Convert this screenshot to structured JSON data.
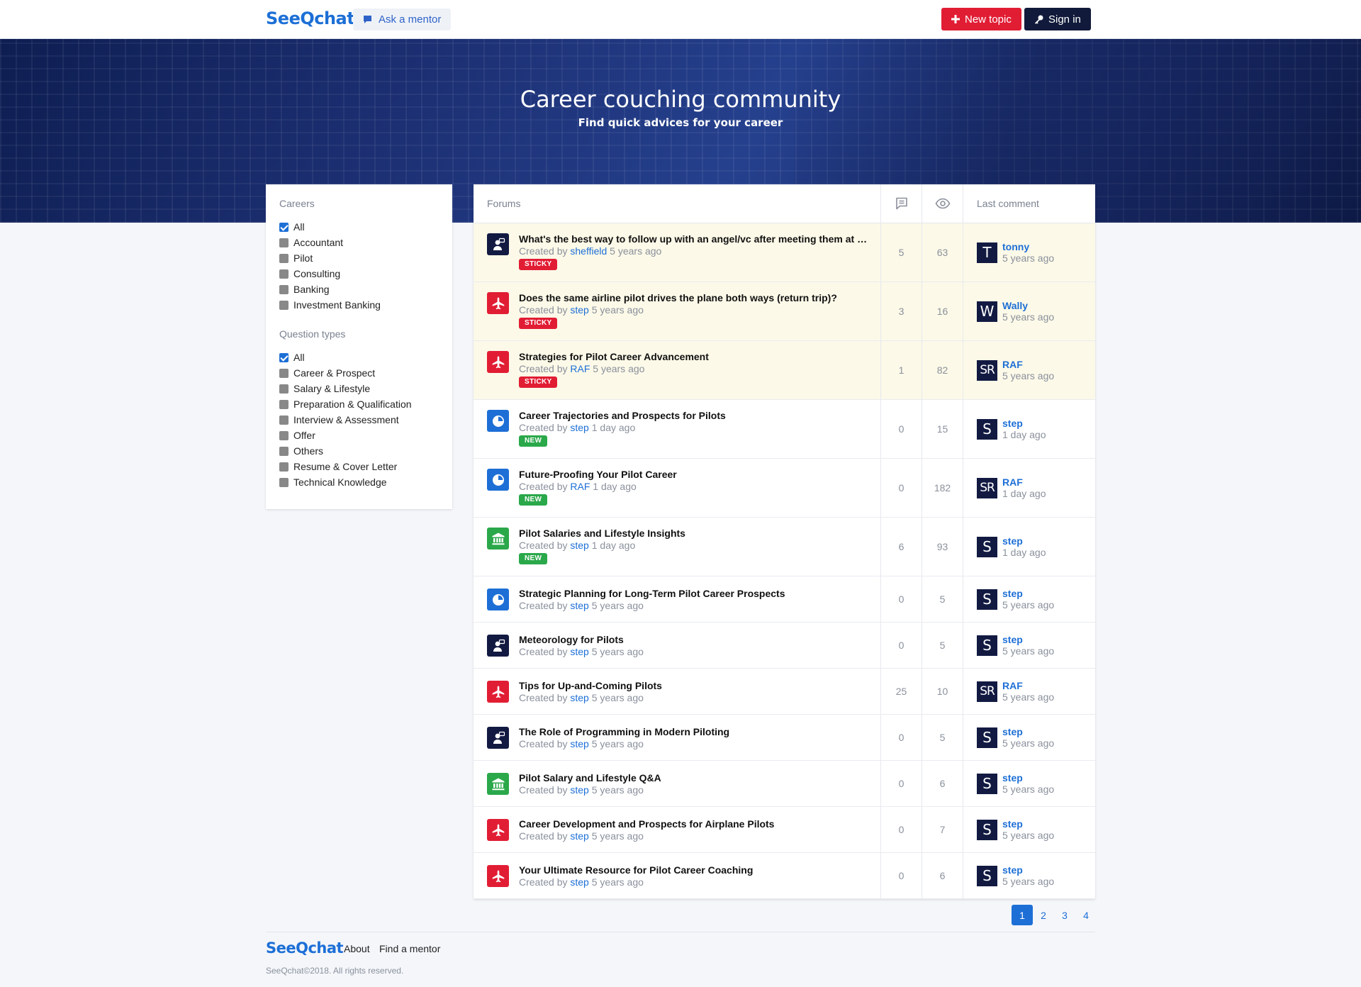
{
  "header": {
    "logo": "SeeQchat",
    "ask_mentor": "Ask a mentor",
    "new_topic": "New topic",
    "sign_in": "Sign in"
  },
  "hero": {
    "title": "Career couching community",
    "subtitle": "Find quick advices for your career"
  },
  "sidebar": {
    "careers_heading": "Careers",
    "careers": [
      {
        "label": "All",
        "checked": true
      },
      {
        "label": "Accountant",
        "checked": false
      },
      {
        "label": "Pilot",
        "checked": false
      },
      {
        "label": "Consulting",
        "checked": false
      },
      {
        "label": "Banking",
        "checked": false
      },
      {
        "label": "Investment Banking",
        "checked": false
      }
    ],
    "types_heading": "Question types",
    "types": [
      {
        "label": "All",
        "checked": true
      },
      {
        "label": "Career & Prospect",
        "checked": false
      },
      {
        "label": "Salary & Lifestyle",
        "checked": false
      },
      {
        "label": "Preparation & Qualification",
        "checked": false
      },
      {
        "label": "Interview & Assessment",
        "checked": false
      },
      {
        "label": "Offer",
        "checked": false
      },
      {
        "label": "Others",
        "checked": false
      },
      {
        "label": "Resume & Cover Letter",
        "checked": false
      },
      {
        "label": "Technical Knowledge",
        "checked": false
      }
    ]
  },
  "table": {
    "col_forums": "Forums",
    "col_last": "Last comment",
    "created_by": "Created by",
    "rows": [
      {
        "title": "What's the best way to follow up with an angel/vc after meeting them at an event?",
        "author": "sheffield",
        "when": "5 years ago",
        "badge": "STICKY",
        "icon": "mentor",
        "replies": "5",
        "views": "63",
        "last_user": "tonny",
        "last_initials": "T",
        "last_when": "5 years ago"
      },
      {
        "title": "Does the same airline pilot drives the plane both ways (return trip)?",
        "author": "step",
        "when": "5 years ago",
        "badge": "STICKY",
        "icon": "plane",
        "replies": "3",
        "views": "16",
        "last_user": "Wally",
        "last_initials": "W",
        "last_when": "5 years ago"
      },
      {
        "title": "Strategies for Pilot Career Advancement",
        "author": "RAF",
        "when": "5 years ago",
        "badge": "STICKY",
        "icon": "plane",
        "replies": "1",
        "views": "82",
        "last_user": "RAF",
        "last_initials": "SR",
        "last_when": "5 years ago"
      },
      {
        "title": "Career Trajectories and Prospects for Pilots",
        "author": "step",
        "when": "1 day ago",
        "badge": "NEW",
        "icon": "chart",
        "replies": "0",
        "views": "15",
        "last_user": "step",
        "last_initials": "S",
        "last_when": "1 day ago"
      },
      {
        "title": "Future-Proofing Your Pilot Career",
        "author": "RAF",
        "when": "1 day ago",
        "badge": "NEW",
        "icon": "chart",
        "replies": "0",
        "views": "182",
        "last_user": "RAF",
        "last_initials": "SR",
        "last_when": "1 day ago"
      },
      {
        "title": "Pilot Salaries and Lifestyle Insights",
        "author": "step",
        "when": "1 day ago",
        "badge": "NEW",
        "icon": "bank",
        "replies": "6",
        "views": "93",
        "last_user": "step",
        "last_initials": "S",
        "last_when": "1 day ago"
      },
      {
        "title": "Strategic Planning for Long-Term Pilot Career Prospects",
        "author": "step",
        "when": "5 years ago",
        "badge": "",
        "icon": "chart",
        "replies": "0",
        "views": "5",
        "last_user": "step",
        "last_initials": "S",
        "last_when": "5 years ago"
      },
      {
        "title": "Meteorology for Pilots",
        "author": "step",
        "when": "5 years ago",
        "badge": "",
        "icon": "mentor",
        "replies": "0",
        "views": "5",
        "last_user": "step",
        "last_initials": "S",
        "last_when": "5 years ago"
      },
      {
        "title": "Tips for Up-and-Coming Pilots",
        "author": "step",
        "when": "5 years ago",
        "badge": "",
        "icon": "plane",
        "replies": "25",
        "views": "10",
        "last_user": "RAF",
        "last_initials": "SR",
        "last_when": "5 years ago"
      },
      {
        "title": "The Role of Programming in Modern Piloting",
        "author": "step",
        "when": "5 years ago",
        "badge": "",
        "icon": "mentor",
        "replies": "0",
        "views": "5",
        "last_user": "step",
        "last_initials": "S",
        "last_when": "5 years ago"
      },
      {
        "title": "Pilot Salary and Lifestyle Q&A",
        "author": "step",
        "when": "5 years ago",
        "badge": "",
        "icon": "bank",
        "replies": "0",
        "views": "6",
        "last_user": "step",
        "last_initials": "S",
        "last_when": "5 years ago"
      },
      {
        "title": "Career Development and Prospects for Airplane Pilots",
        "author": "step",
        "when": "5 years ago",
        "badge": "",
        "icon": "plane",
        "replies": "0",
        "views": "7",
        "last_user": "step",
        "last_initials": "S",
        "last_when": "5 years ago"
      },
      {
        "title": "Your Ultimate Resource for Pilot Career Coaching",
        "author": "step",
        "when": "5 years ago",
        "badge": "",
        "icon": "plane",
        "replies": "0",
        "views": "6",
        "last_user": "step",
        "last_initials": "S",
        "last_when": "5 years ago"
      }
    ]
  },
  "icon_colors": {
    "mentor": "#121a42",
    "plane": "#e11d34",
    "chart": "#1d6fd6",
    "bank": "#2aa84a"
  },
  "pagination": {
    "pages": [
      "1",
      "2",
      "3",
      "4"
    ],
    "current": "1"
  },
  "footer": {
    "logo": "SeeQchat",
    "about": "About",
    "find_mentor": "Find a mentor",
    "copyright": "SeeQchat©2018. All rights reserved."
  }
}
